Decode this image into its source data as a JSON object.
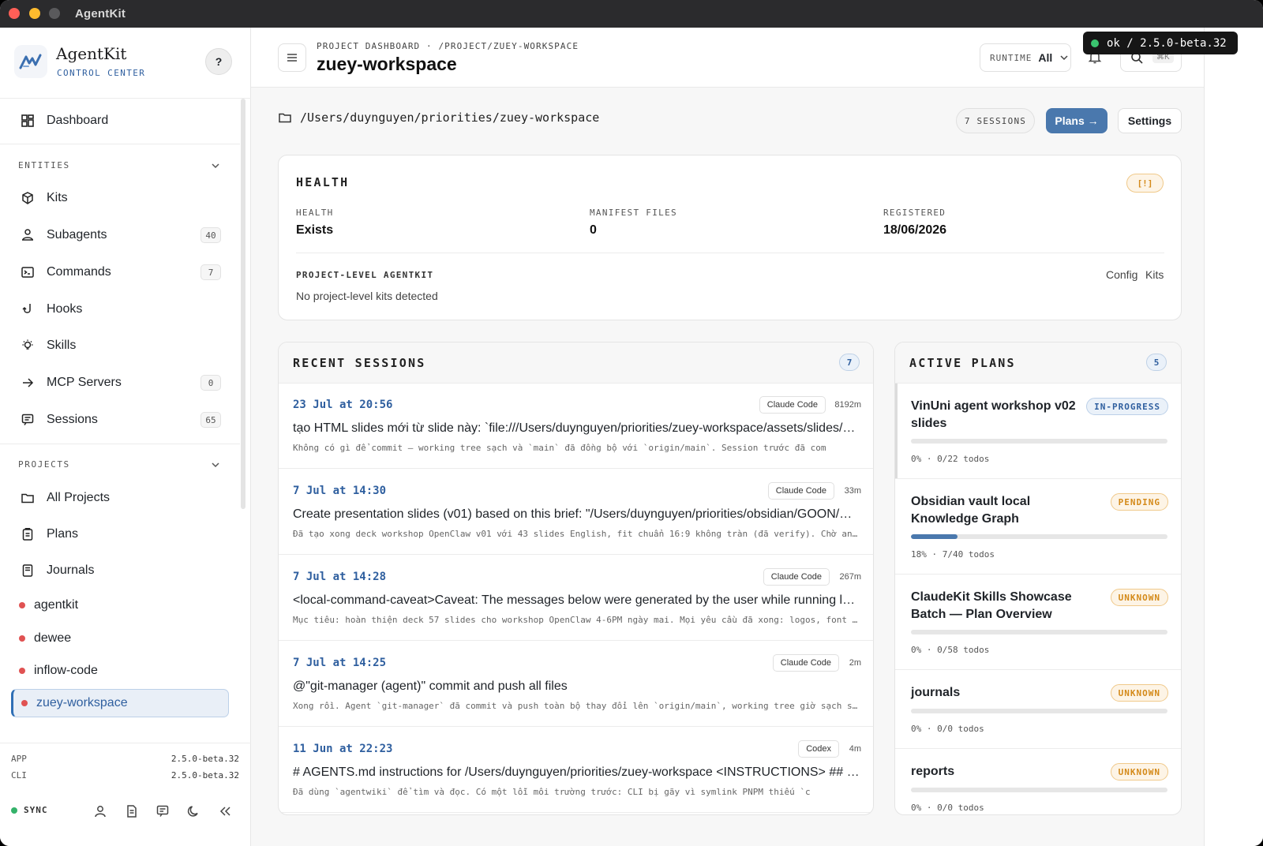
{
  "window": {
    "title": "AgentKit"
  },
  "brand": {
    "name": "AgentKit",
    "subtitle": "CONTROL CENTER",
    "help": "?"
  },
  "sidebar": {
    "dashboard": "Dashboard",
    "entities_header": "ENTITIES",
    "entities": [
      {
        "label": "Kits",
        "icon": "cube-icon",
        "count": ""
      },
      {
        "label": "Subagents",
        "icon": "users-icon",
        "count": "40"
      },
      {
        "label": "Commands",
        "icon": "terminal-icon",
        "count": "7"
      },
      {
        "label": "Hooks",
        "icon": "hook-icon",
        "count": ""
      },
      {
        "label": "Skills",
        "icon": "lightbulb-icon",
        "count": ""
      },
      {
        "label": "MCP Servers",
        "icon": "arrow-right-icon",
        "count": "0"
      },
      {
        "label": "Sessions",
        "icon": "chat-icon",
        "count": "65"
      }
    ],
    "projects_header": "PROJECTS",
    "project_links": [
      {
        "label": "All Projects",
        "icon": "folder-icon"
      },
      {
        "label": "Plans",
        "icon": "clipboard-icon"
      },
      {
        "label": "Journals",
        "icon": "book-icon"
      }
    ],
    "projects": [
      "agentkit",
      "dewee",
      "inflow-code",
      "zuey-workspace"
    ],
    "active_project": "zuey-workspace",
    "footer": {
      "app_label": "APP",
      "app_version": "2.5.0-beta.32",
      "cli_label": "CLI",
      "cli_version": "2.5.0-beta.32",
      "sync_label": "SYNC"
    }
  },
  "topbar": {
    "breadcrumb": "PROJECT DASHBOARD · /PROJECT/ZUEY-WORKSPACE",
    "title": "zuey-workspace",
    "runtime_label": "RUNTIME",
    "runtime_value": "All",
    "search_kbd": "⌘K"
  },
  "toast": {
    "text": "ok / 2.5.0-beta.32"
  },
  "project": {
    "path": "/Users/duynguyen/priorities/zuey-workspace",
    "sessions_badge": "7 SESSIONS",
    "plans_button": "Plans →",
    "settings_button": "Settings"
  },
  "health": {
    "title": "HEALTH",
    "warning_badge": "[!]",
    "health_label": "HEALTH",
    "health_value": "Exists",
    "manifest_label": "MANIFEST FILES",
    "manifest_value": "0",
    "registered_label": "REGISTERED",
    "registered_value": "18/06/2026",
    "project_level_label": "PROJECT-LEVEL AGENTKIT",
    "project_level_value": "No project-level kits detected",
    "config_link": "Config",
    "kits_link": "Kits"
  },
  "recent_sessions": {
    "title": "RECENT SESSIONS",
    "count": "7",
    "items": [
      {
        "date": "23 Jul at 20:56",
        "tool": "Claude Code",
        "duration": "8192m",
        "message": "tạo HTML slides mới từ slide này: `file:///Users/duynguyen/priorities/zuey-workspace/assets/slides/…",
        "summary": "Không có gì để commit — working tree sạch và `main` đã đồng bộ với `origin/main`. Session trước đã com"
      },
      {
        "date": "7 Jul at 14:30",
        "tool": "Claude Code",
        "duration": "33m",
        "message": "Create presentation slides (v01) based on this brief: \"/Users/duynguyen/priorities/obsidian/GOON/O…",
        "summary": "Đã tạo xong deck workshop OpenClaw v01 với 43 slides English, fit chuẩn 16:9 không tràn (đã verify). Chờ an…"
      },
      {
        "date": "7 Jul at 14:28",
        "tool": "Claude Code",
        "duration": "267m",
        "message": "<local-command-caveat>Caveat: The messages below were generated by the user while running loc…",
        "summary": "Mục tiêu: hoàn thiện deck 57 slides cho workshop OpenClaw 4-6PM ngày mai. Mọi yêu cầu đã xong: logos, font …"
      },
      {
        "date": "7 Jul at 14:25",
        "tool": "Claude Code",
        "duration": "2m",
        "message": "@\"git-manager (agent)\" commit and push all files",
        "summary": "Xong rồi. Agent `git-manager` đã commit và push toàn bộ thay đổi lên `origin/main`, working tree giờ sạch s…"
      },
      {
        "date": "11 Jun at 22:23",
        "tool": "Codex",
        "duration": "4m",
        "message": "# AGENTS.md instructions for /Users/duynguyen/priorities/zuey-workspace <INSTRUCTIONS> ## Con…",
        "summary": "Đã dùng `agentwiki` để tìm và đọc. Có một lỗi môi trường trước: CLI bị gãy vì symlink PNPM thiếu `c"
      }
    ]
  },
  "active_plans": {
    "title": "ACTIVE PLANS",
    "count": "5",
    "items": [
      {
        "title": "VinUni agent workshop v02 slides",
        "status": "IN-PROGRESS",
        "progress": 0.0,
        "meta": "0% · 0/22 todos"
      },
      {
        "title": "Obsidian vault local Knowledge Graph",
        "status": "PENDING",
        "progress": 0.18,
        "meta": "18% · 7/40 todos"
      },
      {
        "title": "ClaudeKit Skills Showcase Batch — Plan Overview",
        "status": "UNKNOWN",
        "progress": 0.0,
        "meta": "0% · 0/58 todos"
      },
      {
        "title": "journals",
        "status": "UNKNOWN",
        "progress": 0.0,
        "meta": "0% · 0/0 todos"
      },
      {
        "title": "reports",
        "status": "UNKNOWN",
        "progress": 0.0,
        "meta": "0% · 0/0 todos"
      }
    ]
  },
  "colors": {
    "accent": "#4a78ad",
    "link": "#2f5f9f",
    "warning": "#d48a1a",
    "status_ok": "#34b26a",
    "project_dot": "#e05252"
  }
}
